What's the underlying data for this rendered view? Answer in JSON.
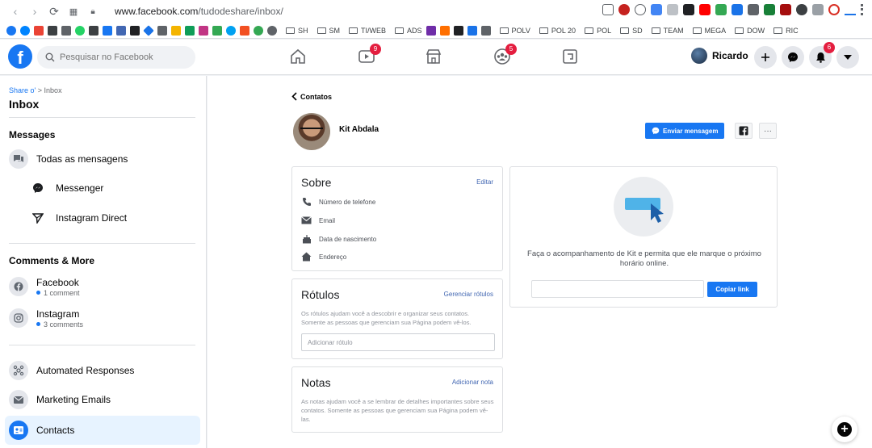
{
  "browser": {
    "url_host": "www.facebook.com",
    "url_path": "/tudodeshare/inbox/",
    "bookmark_folders": [
      "SH",
      "SM",
      "TI/WEB",
      "ADS",
      "POLV",
      "POL 20",
      "POL",
      "SD",
      "TEAM",
      "MEGA",
      "DOW",
      "RIC"
    ],
    "colors": {
      "chrome_bg": "#ffffff"
    }
  },
  "header": {
    "logo": "f",
    "search_placeholder": "Pesquisar no Facebook",
    "nav": [
      {
        "icon": "home-icon",
        "badge": ""
      },
      {
        "icon": "watch-icon",
        "badge": "9"
      },
      {
        "icon": "marketplace-icon",
        "badge": ""
      },
      {
        "icon": "groups-icon",
        "badge": "5"
      },
      {
        "icon": "gaming-icon",
        "badge": ""
      }
    ],
    "profile_name": "Ricardo",
    "notifications_badge": "6"
  },
  "sidebar": {
    "breadcrumb_link": "Share o'",
    "breadcrumb_sep": ">",
    "breadcrumb_current": "Inbox",
    "title": "Inbox",
    "messages_title": "Messages",
    "all_messages": "Todas as mensagens",
    "messenger": "Messenger",
    "instagram_direct": "Instagram Direct",
    "comments_title": "Comments & More",
    "facebook_label": "Facebook",
    "facebook_meta": "1 comment",
    "instagram_label": "Instagram",
    "instagram_meta": "3 comments",
    "automated": "Automated Responses",
    "marketing": "Marketing Emails",
    "contacts": "Contacts"
  },
  "main": {
    "back_label": "Contatos",
    "contact_name": "Kit Abdala",
    "send_message": "Enviar mensagem",
    "about": {
      "title": "Sobre",
      "action": "Editar",
      "fields": [
        "Número de telefone",
        "Email",
        "Data de nascimento",
        "Endereço"
      ]
    },
    "labels": {
      "title": "Rótulos",
      "action": "Gerenciar rótulos",
      "help": "Os rótulos ajudam você a descobrir e organizar seus contatos. Somente as pessoas que gerenciam sua Página podem vê-los.",
      "placeholder": "Adicionar rótulo"
    },
    "notes": {
      "title": "Notas",
      "action": "Adicionar nota",
      "help": "As notas ajudam você a se lembrar de detalhes importantes sobre seus contatos. Somente as pessoas que gerenciam sua Página podem vê-las."
    },
    "follow": {
      "text": "Faça o acompanhamento de Kit e permita que ele marque o próximo horário online.",
      "copy_button": "Copiar link"
    }
  },
  "colors": {
    "brand": "#1877f2",
    "badge": "#e41e3f",
    "active_bg": "#e7f3ff"
  }
}
